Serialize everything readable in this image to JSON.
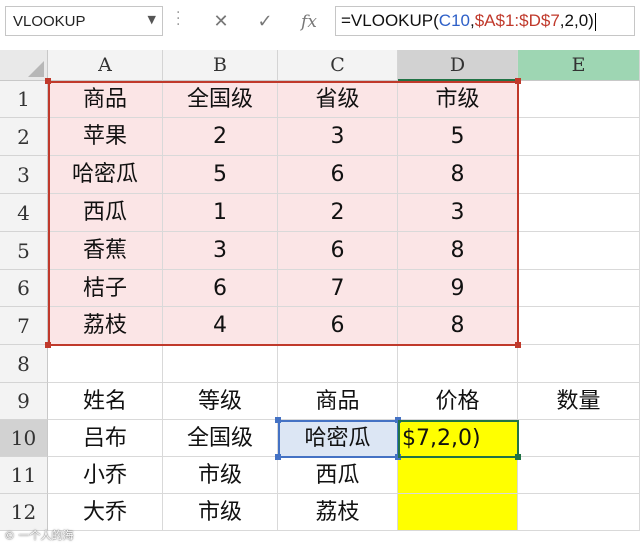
{
  "formula_bar": {
    "name_box": "VLOOKUP",
    "cancel_glyph": "✕",
    "enter_glyph": "✓",
    "fx_glyph": "fx",
    "formula_parts": [
      {
        "text": "=VLOOKUP(",
        "color": "black"
      },
      {
        "text": "C10",
        "color": "blue"
      },
      {
        "text": ",",
        "color": "black"
      },
      {
        "text": "$A$1:$D$7",
        "color": "red"
      },
      {
        "text": ",2,0)",
        "color": "black"
      }
    ]
  },
  "columns": [
    "A",
    "B",
    "C",
    "D",
    "E"
  ],
  "rows": [
    "1",
    "2",
    "3",
    "4",
    "5",
    "6",
    "7",
    "8",
    "9",
    "10",
    "11",
    "12"
  ],
  "table1": {
    "headers": [
      "商品",
      "全国级",
      "省级",
      "市级"
    ],
    "rows": [
      [
        "苹果",
        "2",
        "3",
        "5"
      ],
      [
        "哈密瓜",
        "5",
        "6",
        "8"
      ],
      [
        "西瓜",
        "1",
        "2",
        "3"
      ],
      [
        "香蕉",
        "3",
        "6",
        "8"
      ],
      [
        "桔子",
        "6",
        "7",
        "9"
      ],
      [
        "荔枝",
        "4",
        "6",
        "8"
      ]
    ]
  },
  "table2": {
    "headers": [
      "姓名",
      "等级",
      "商品",
      "价格",
      "数量"
    ],
    "rows": [
      [
        "吕布",
        "全国级",
        "哈密瓜",
        "$7,2,0)",
        ""
      ],
      [
        "小乔",
        "市级",
        "西瓜",
        "",
        ""
      ],
      [
        "大乔",
        "市级",
        "荔枝",
        "",
        ""
      ]
    ]
  },
  "watermark": "© 一个人的海",
  "colors": {
    "range_red": "#c0392b",
    "ref_blue": "#4472c4",
    "pink_fill": "#fbe5e6",
    "yellow_fill": "#ffff00",
    "select_green": "#217346"
  }
}
